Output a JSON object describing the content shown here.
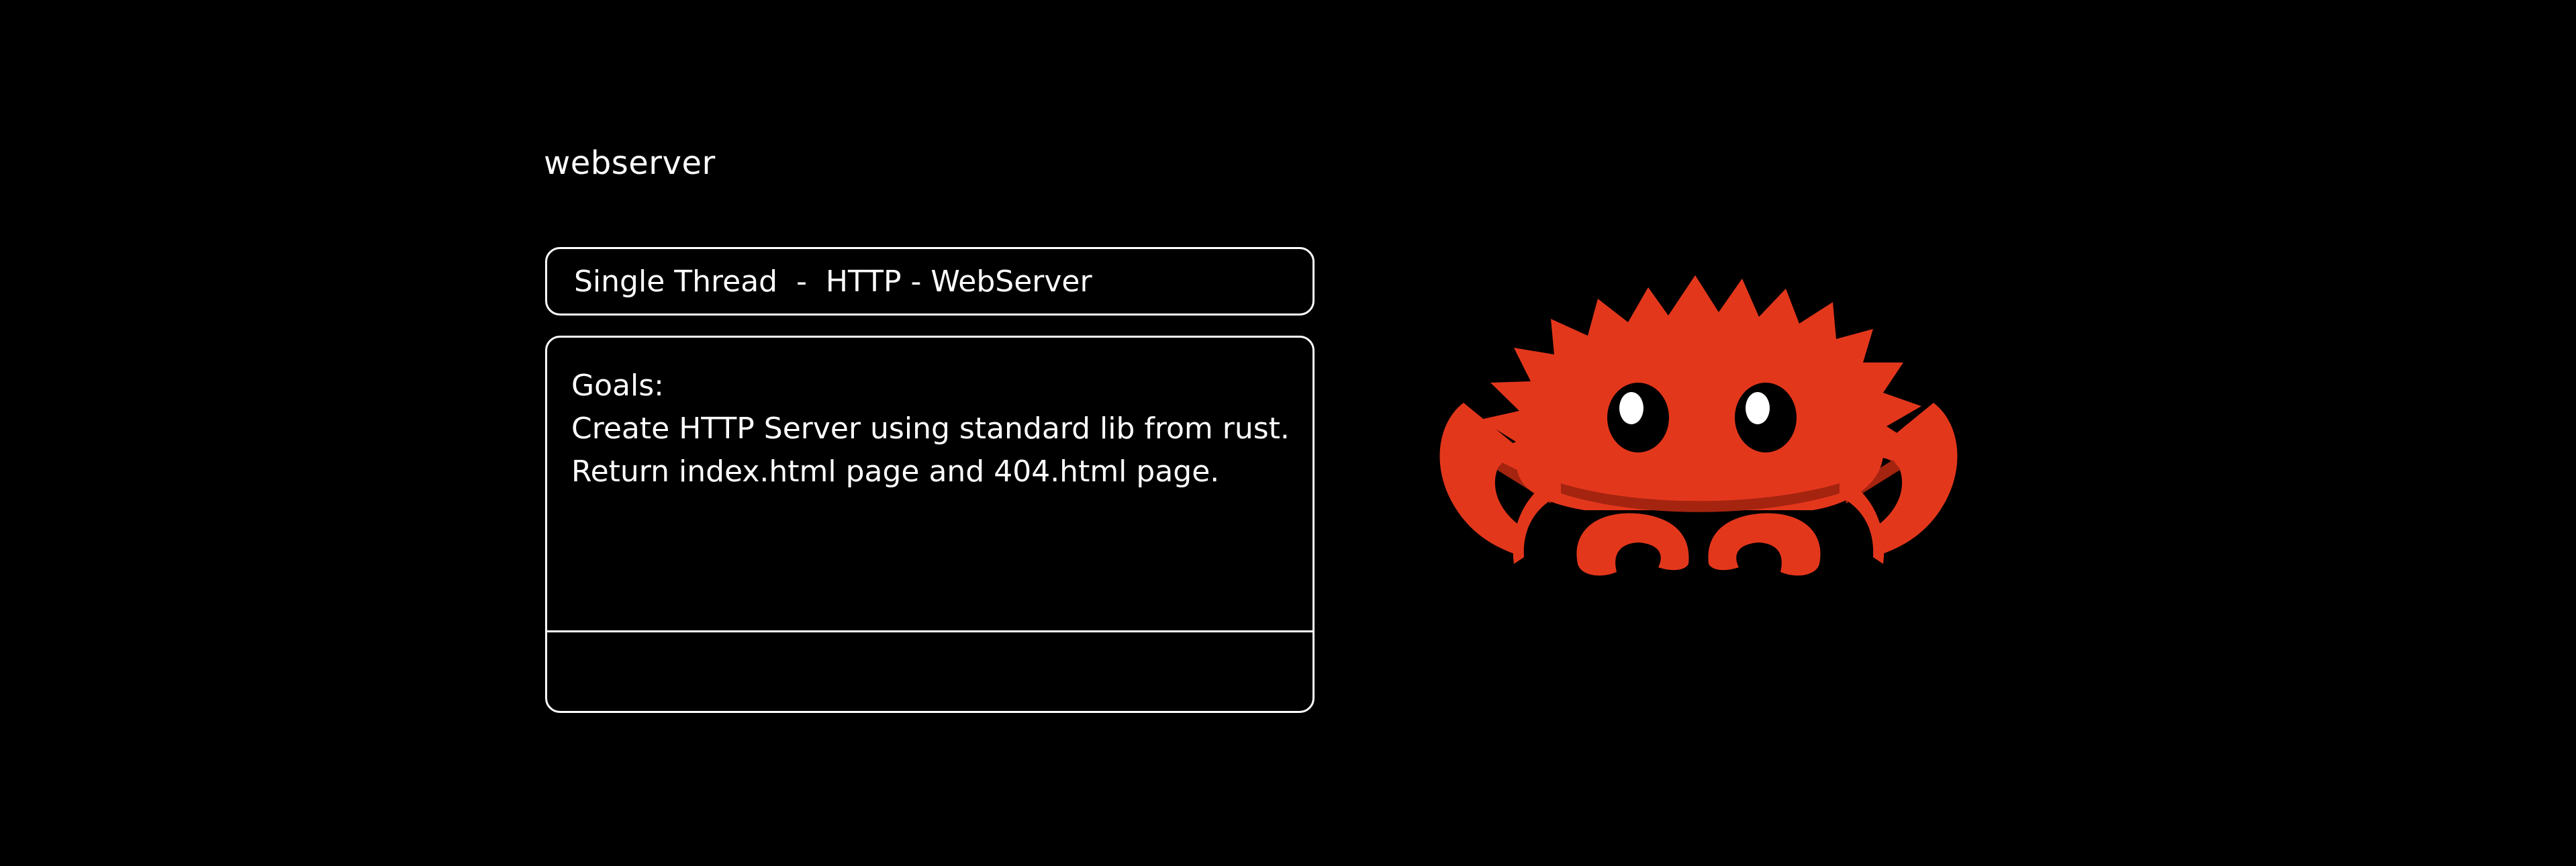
{
  "header": {
    "title": "webserver"
  },
  "summary": {
    "text": "Single Thread  -  HTTP - WebServer"
  },
  "goals": {
    "heading": "Goals:",
    "lines": [
      "Create HTTP Server using standard lib from rust.",
      "Return index.html page and 404.html page."
    ]
  },
  "mascot": {
    "icon": "rust-crab-ferris-icon",
    "color": "#E3371C",
    "shadow_color": "#A52410"
  }
}
